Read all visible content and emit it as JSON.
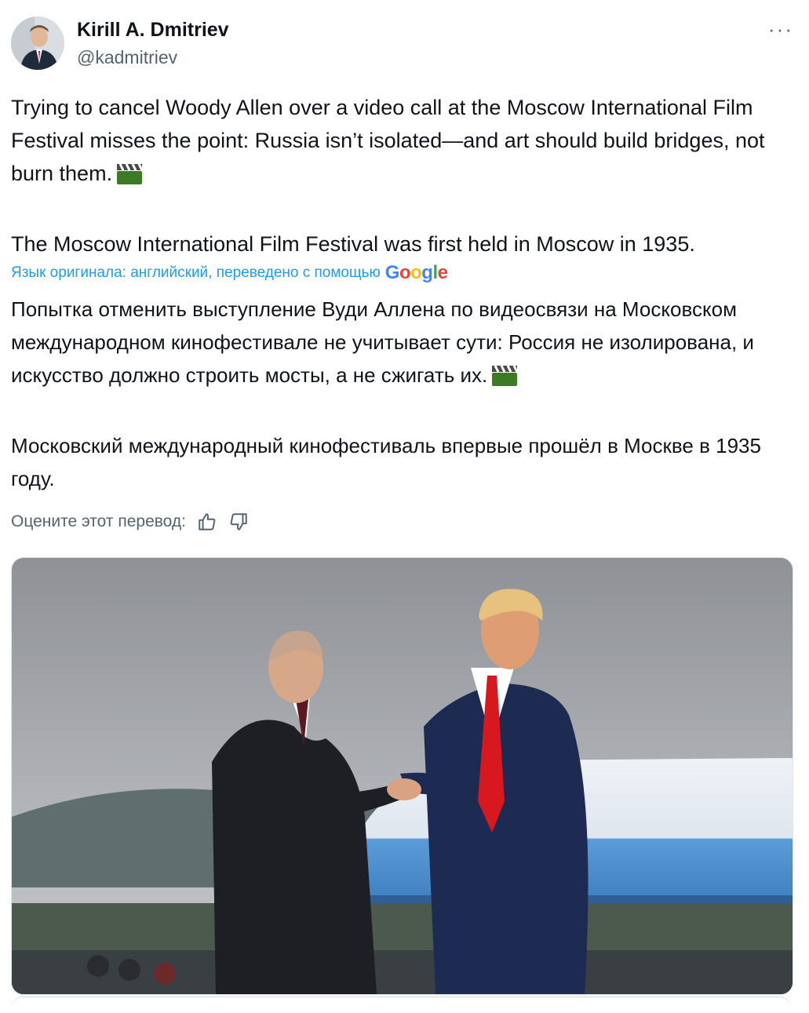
{
  "author": {
    "name": "Kirill A. Dmitriev",
    "handle": "@kadmitriev"
  },
  "more_label": "···",
  "tweet": {
    "paragraph1": "Trying to cancel Woody Allen over a video call at the Moscow International Film Festival misses the point: Russia isn’t isolated—and art should build bridges, not burn them.",
    "paragraph2": "The Moscow International Film Festival was first held in Moscow in 1935."
  },
  "translation": {
    "notice": "Язык оригинала: английский, переведено с помощью",
    "provider": "Google",
    "paragraph1": "Попытка отменить выступление Вуди Аллена по видеосвязи на Московском международном кинофестивале не учитывает сути: Россия не изолирована, и искусство должно строить мосты, а не сжигать их.",
    "paragraph2": "Московский международный кинофестиваль впервые прошёл в Москве в 1935 году.",
    "rate_label": "Оцените этот перевод:"
  },
  "icons": {
    "emoji": "clapper-board-icon",
    "thumbs_up": "thumbs-up-icon",
    "thumbs_down": "thumbs-down-icon"
  },
  "colors": {
    "link": "#1d9bf0",
    "secondary_text": "#536471",
    "google_blue": "#4285f4",
    "google_red": "#ea4335",
    "google_yellow": "#fbbc05",
    "google_green": "#34a853"
  }
}
